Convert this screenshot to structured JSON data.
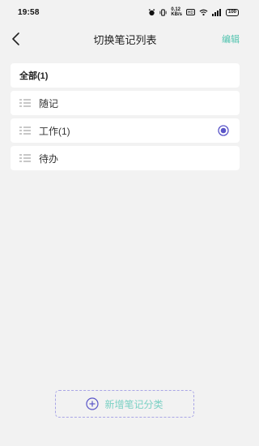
{
  "status_bar": {
    "time": "19:58",
    "network_speed": "0.12\nKB/s",
    "battery": "100"
  },
  "header": {
    "title": "切换笔记列表",
    "edit_label": "编辑"
  },
  "list": {
    "all_label": "全部(1)",
    "items": [
      {
        "label": "随记",
        "selected": false
      },
      {
        "label": "工作(1)",
        "selected": true
      },
      {
        "label": "待办",
        "selected": false
      }
    ]
  },
  "footer": {
    "add_label": "新增笔记分类"
  },
  "colors": {
    "accent_teal": "#4fc3ae",
    "accent_purple": "#5a55c8",
    "dashed_border": "#a9a6e6"
  }
}
